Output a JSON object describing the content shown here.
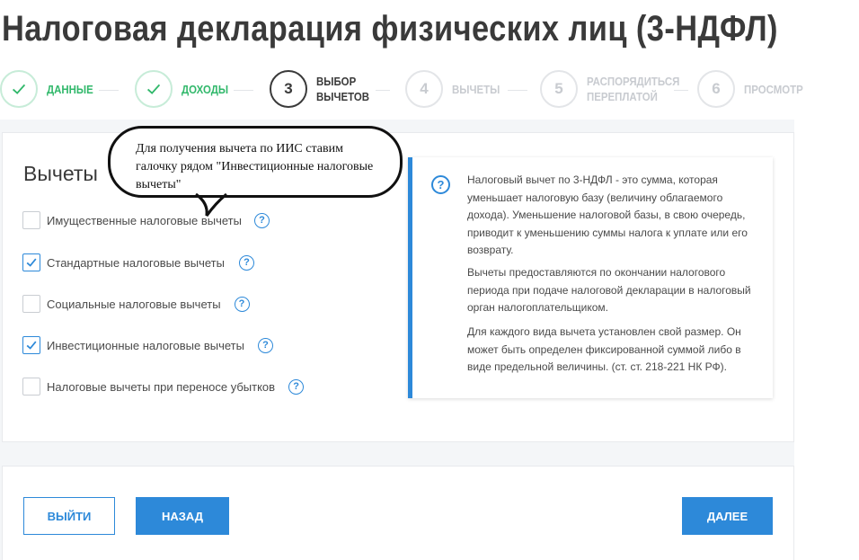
{
  "page": {
    "title": "Налоговая декларация физических лиц (3-НДФЛ)"
  },
  "stepper": [
    {
      "status": "done",
      "number": "",
      "label_line1": "ДАННЫЕ",
      "label_line2": ""
    },
    {
      "status": "done",
      "number": "",
      "label_line1": "ДОХОДЫ",
      "label_line2": ""
    },
    {
      "status": "active",
      "number": "3",
      "label_line1": "ВЫБОР",
      "label_line2": "ВЫЧЕТОВ"
    },
    {
      "status": "pending",
      "number": "4",
      "label_line1": "ВЫЧЕТЫ",
      "label_line2": ""
    },
    {
      "status": "pending",
      "number": "5",
      "label_line1": "РАСПОРЯДИТЬСЯ",
      "label_line2": "ПЕРЕПЛАТОЙ"
    },
    {
      "status": "pending",
      "number": "6",
      "label_line1": "ПРОСМОТР",
      "label_line2": ""
    }
  ],
  "section": {
    "title": "Вычеты"
  },
  "options": [
    {
      "label": "Имущественные налоговые вычеты",
      "checked": false
    },
    {
      "label": "Стандартные налоговые вычеты",
      "checked": true
    },
    {
      "label": "Социальные налоговые вычеты",
      "checked": false
    },
    {
      "label": "Инвестиционные налоговые вычеты",
      "checked": true
    },
    {
      "label": "Налоговые вычеты при переносе убытков",
      "checked": false
    }
  ],
  "help_icon": "?",
  "info": {
    "icon": "question-circle-icon",
    "paragraphs": [
      "Налоговый вычет по 3-НДФЛ - это сумма, которая уменьшает налоговую базу (величину облагаемого дохода). Уменьшение налоговой базы, в свою очередь, приводит к уменьшению суммы налога к уплате или его возврату.",
      "Вычеты предоставляются по окончании налогового периода при подаче налоговой декларации в налоговый орган налогоплательщиком.",
      "Для каждого вида вычета установлен свой размер. Он может быть определен фиксированной суммой либо в виде предельной величины. (ст. ст. 218-221 НК РФ)."
    ]
  },
  "callout": {
    "text": "Для получения вычета по ИИС ставим галочку рядом \"Инвестиционные налоговые вычеты\""
  },
  "buttons": {
    "exit": "ВЫЙТИ",
    "back": "НАЗАД",
    "next": "ДАЛЕЕ"
  },
  "colors": {
    "accent": "#2d89d9",
    "success": "#31b86b",
    "text": "#3a3a3a"
  }
}
